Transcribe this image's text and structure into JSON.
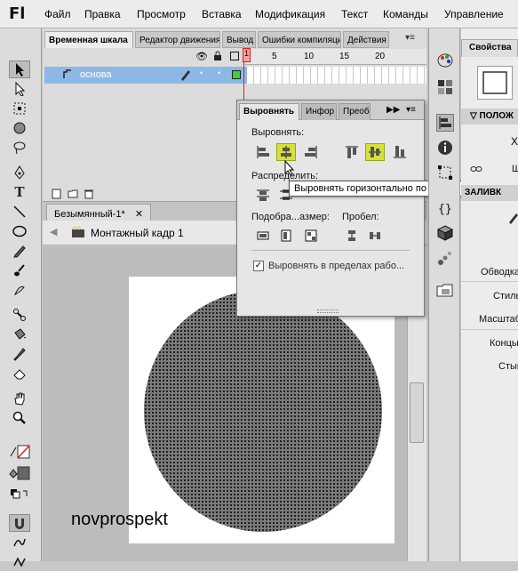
{
  "app": {
    "logo": "Fl"
  },
  "menu": [
    "Файл",
    "Правка",
    "Просмотр",
    "Вставка",
    "Модификация",
    "Текст",
    "Команды",
    "Управление"
  ],
  "timeline": {
    "tabs": [
      "Временная шкала",
      "Редактор движения",
      "Вывод",
      "Ошибки компиляции",
      "Действия"
    ],
    "frame_numbers": [
      "1",
      "5",
      "10",
      "15",
      "20"
    ],
    "layer_name": "основа"
  },
  "document": {
    "tab": "Безымянный-1*",
    "scene": "Монтажный кадр 1",
    "watermark": "novprospekt"
  },
  "align_panel": {
    "tabs": [
      "Выровнять",
      "Инфор",
      "Преоб"
    ],
    "section_align": "Выровнять:",
    "section_distribute": "Распределить:",
    "section_match": "Подобра...азмер:",
    "section_space": "Пробел:",
    "checkbox_label": "Выровнять в пределах рабо...",
    "checkbox_checked": true,
    "tooltip": "Выровнять горизонтально по центру",
    "highlight_color": "#d8e03a"
  },
  "properties": {
    "tab": "Свойства",
    "labels": [
      "ПОЛОЖ",
      "Ш",
      "ЗАЛИВК",
      "Обводка",
      "Стиль",
      "Масштаб",
      "Концы",
      "Стык"
    ]
  }
}
